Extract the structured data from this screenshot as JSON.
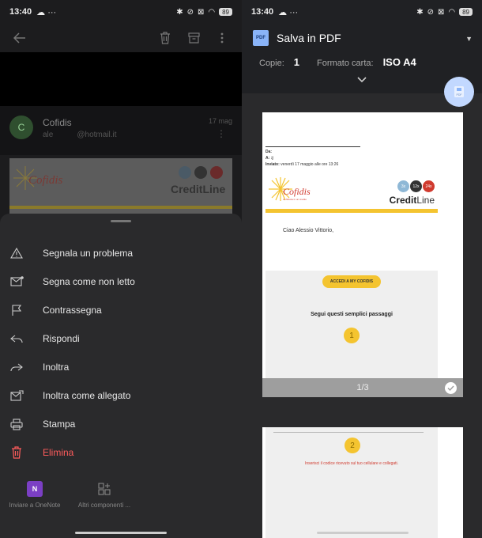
{
  "status": {
    "time": "13:40",
    "battery": "89"
  },
  "mail": {
    "avatar_letter": "C",
    "sender_name": "Cofidis",
    "sender_user": "ale",
    "sender_domain": "@hotmail.it",
    "date": "17 mag"
  },
  "menu": {
    "items": [
      {
        "label": "Segnala un problema",
        "icon": "warning-icon"
      },
      {
        "label": "Segna come non letto",
        "icon": "mail-unread-icon"
      },
      {
        "label": "Contrassegna",
        "icon": "flag-icon"
      },
      {
        "label": "Rispondi",
        "icon": "reply-icon"
      },
      {
        "label": "Inoltra",
        "icon": "forward-icon"
      },
      {
        "label": "Inoltra come allegato",
        "icon": "forward-attachment-icon"
      },
      {
        "label": "Stampa",
        "icon": "print-icon"
      },
      {
        "label": "Elimina",
        "icon": "delete-icon",
        "color": "#ff5c5c"
      }
    ],
    "apps": [
      {
        "label": "Inviare a OneNote",
        "icon": "onenote-icon",
        "glyph": "N"
      },
      {
        "label": "Altri componenti ...",
        "icon": "add-apps-icon"
      }
    ]
  },
  "print": {
    "printer_name": "Salva in PDF",
    "pdf_icon_label": "PDF",
    "copies_label": "Copie:",
    "copies_value": "1",
    "paper_label": "Formato carta:",
    "paper_value": "ISO A4",
    "fab_label": "PDF"
  },
  "preview": {
    "meta_da": "Da:",
    "meta_a": "A: :j",
    "meta_inviato_label": "Inviato:",
    "meta_inviato_value": "venerdì 17 maggio alle ore 13:26",
    "logo_text": "Cofidis",
    "logo_sub": "La fiducia in un credito",
    "badges": [
      "3x",
      "12x",
      "24x"
    ],
    "creditline_a": "Credit",
    "creditline_b": "Line",
    "greeting": "Ciao Alessio Vittorio,",
    "cta": "ACCEDI A MY COFIDIS",
    "steps_title": "Segui questi semplici passaggi",
    "step1": "1",
    "page_counter": "1/3",
    "step2": "2",
    "step2_text": "Inserisci il codice ricevuto sul tuo cellulare e collegati."
  },
  "colors": {
    "accent_yellow": "#f4c430",
    "danger": "#ff5c5c",
    "brand_red": "#d03a2e",
    "pdf_blue": "#8ab4f8"
  }
}
